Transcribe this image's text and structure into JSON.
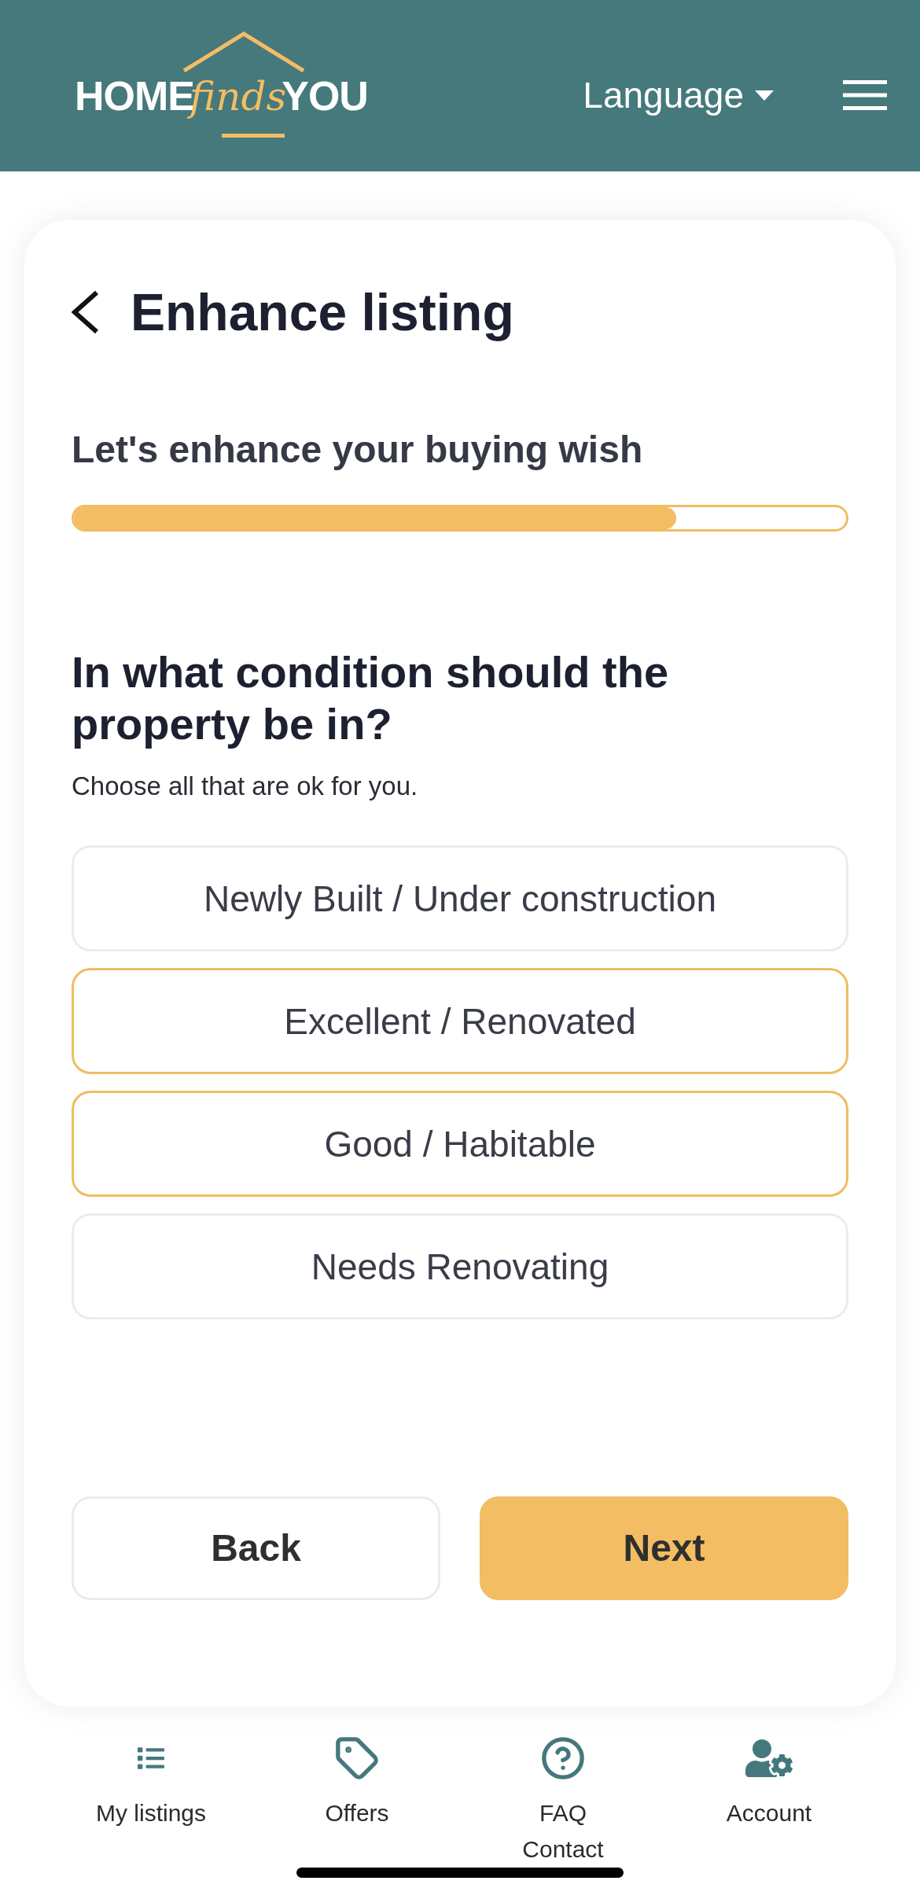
{
  "header": {
    "logo": {
      "lead": "HOME",
      "script": "finds",
      "tail": "YOU"
    },
    "language_menu": {
      "label": "Language"
    }
  },
  "page": {
    "title": "Enhance listing"
  },
  "wizard": {
    "subtitle": "Let's enhance your buying wish",
    "progress": {
      "level": 0.78
    }
  },
  "question": {
    "heading": "In what condition should the property be in?",
    "hint": "Choose all that are ok for you.",
    "options": [
      {
        "label": "Newly Built / Under construction",
        "selected": false
      },
      {
        "label": "Excellent / Renovated",
        "selected": true
      },
      {
        "label": "Good / Habitable",
        "selected": true
      },
      {
        "label": "Needs Renovating",
        "selected": false
      }
    ]
  },
  "actions": [
    {
      "label": "Back",
      "kind": "secondary"
    },
    {
      "label": "Next",
      "kind": "primary"
    }
  ],
  "bottom_nav": [
    {
      "label": "My listings"
    },
    {
      "label": "Offers"
    },
    {
      "label": "FAQ Contact"
    },
    {
      "label": "Account"
    }
  ]
}
